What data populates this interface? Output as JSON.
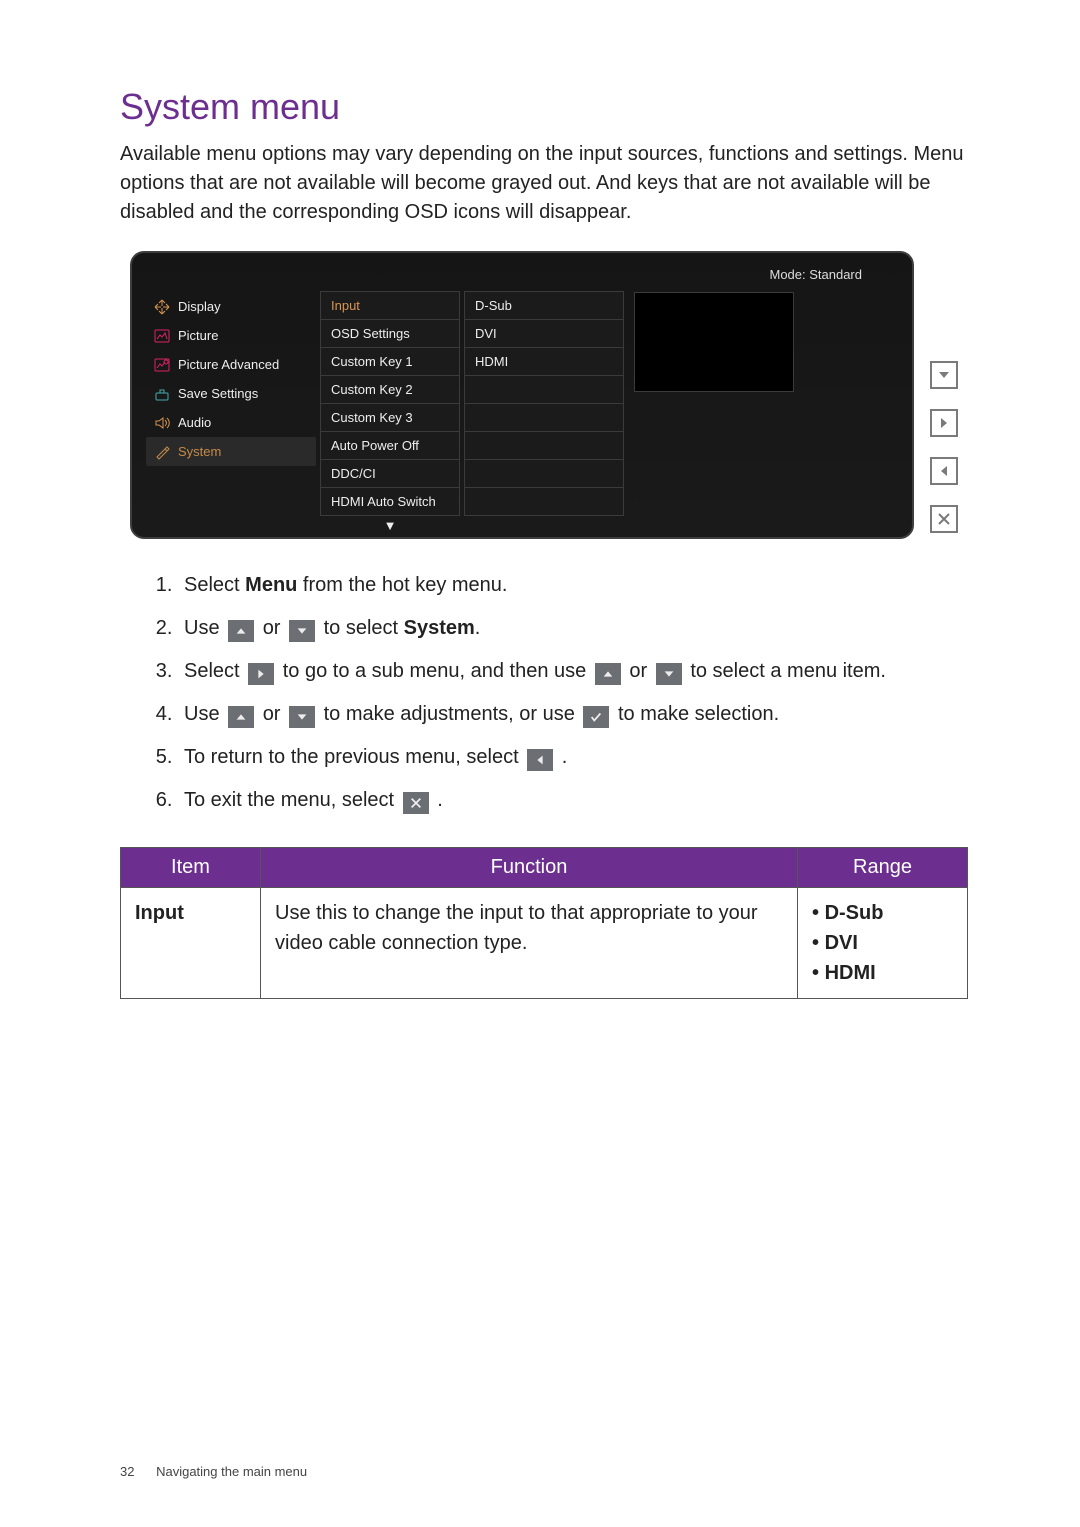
{
  "title": "System menu",
  "intro": "Available menu options may vary depending on the input sources, functions and settings. Menu options that are not available will become grayed out. And keys that are not available will be disabled and the corresponding OSD icons will disappear.",
  "osd": {
    "mode_label": "Mode: Standard",
    "nav": [
      {
        "label": "Display",
        "selected": false
      },
      {
        "label": "Picture",
        "selected": false
      },
      {
        "label": "Picture Advanced",
        "selected": false
      },
      {
        "label": "Save Settings",
        "selected": false
      },
      {
        "label": "Audio",
        "selected": false
      },
      {
        "label": "System",
        "selected": true
      }
    ],
    "sub": [
      "Input",
      "OSD Settings",
      "Custom Key 1",
      "Custom Key 2",
      "Custom Key 3",
      "Auto Power Off",
      "DDC/CI",
      "HDMI Auto Switch"
    ],
    "sub_active_index": 0,
    "values": [
      "D-Sub",
      "DVI",
      "HDMI"
    ],
    "scroll_hint": "▼"
  },
  "steps": {
    "s1_pre": "Select ",
    "s1_b": "Menu",
    "s1_post": " from the hot key menu.",
    "s2_pre": "Use ",
    "s2_mid": " or ",
    "s2_post": " to select ",
    "s2_b": "System",
    "s2_end": ".",
    "s3_pre": "Select ",
    "s3_mid1": " to go to a sub menu, and then use ",
    "s3_mid2": " or ",
    "s3_post": " to select a menu item.",
    "s4_pre": "Use ",
    "s4_mid1": " or ",
    "s4_mid2": " to make adjustments, or use ",
    "s4_post": " to make selection.",
    "s5_pre": "To return to the previous menu, select ",
    "s5_post": ".",
    "s6_pre": "To exit the menu, select ",
    "s6_post": "."
  },
  "table": {
    "headers": [
      "Item",
      "Function",
      "Range"
    ],
    "rows": [
      {
        "item": "Input",
        "function": "Use this to change the input to that appropriate to your video cable connection type.",
        "range": [
          "D-Sub",
          "DVI",
          "HDMI"
        ]
      }
    ]
  },
  "footer": {
    "page": "32",
    "section": "Navigating the main menu"
  }
}
